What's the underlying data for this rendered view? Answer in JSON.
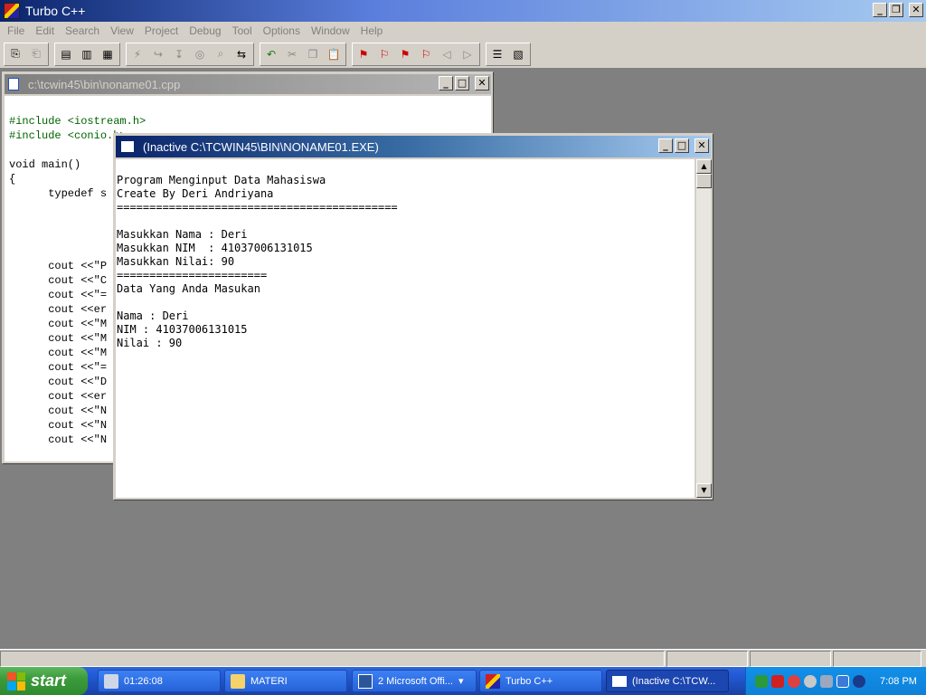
{
  "app": {
    "title": "Turbo C++",
    "controls": {
      "minimize": "_",
      "restore": "❐",
      "close": "✕"
    }
  },
  "menu": [
    "File",
    "Edit",
    "Search",
    "View",
    "Project",
    "Debug",
    "Tool",
    "Options",
    "Window",
    "Help"
  ],
  "editor": {
    "title": "c:\\tcwin45\\bin\\noname01.cpp",
    "lines": [
      "#include <iostream.h>",
      "#include <conio.h>",
      "",
      "void main()",
      "{",
      "      typedef s",
      "",
      "",
      "",
      "",
      "      cout <<\"P",
      "      cout <<\"C",
      "      cout <<\"=",
      "      cout <<er",
      "      cout <<\"M",
      "      cout <<\"M",
      "      cout <<\"M",
      "      cout <<\"=",
      "      cout <<\"D",
      "      cout <<er",
      "      cout <<\"N",
      "      cout <<\"N",
      "      cout <<\"N"
    ]
  },
  "console": {
    "title": "(Inactive C:\\TCWIN45\\BIN\\NONAME01.EXE)",
    "lines": [
      "Program Menginput Data Mahasiswa",
      "Create By Deri Andriyana",
      "===========================================",
      "",
      "Masukkan Nama : Deri",
      "Masukkan NIM  : 41037006131015",
      "Masukkan Nilai: 90",
      "=======================",
      "Data Yang Anda Masukan",
      "",
      "Nama : Deri",
      "NIM : 41037006131015",
      "Nilai : 90"
    ]
  },
  "taskbar": {
    "start": "start",
    "tasks": [
      {
        "label": "01:26:08",
        "icon": "clock-icon"
      },
      {
        "label": "MATERI",
        "icon": "folder-icon"
      },
      {
        "label": "2 Microsoft Offi...",
        "icon": "word-icon",
        "arrow": "▾"
      },
      {
        "label": "Turbo C++",
        "icon": "turbo-icon"
      },
      {
        "label": "(Inactive C:\\TCW...",
        "icon": "console-icon"
      }
    ],
    "clock": "7:08 PM"
  },
  "colors": {
    "title_active": "#0a246a",
    "title_inactive": "#808080",
    "taskbar": "#245edb",
    "start": "#3c9c3c"
  }
}
